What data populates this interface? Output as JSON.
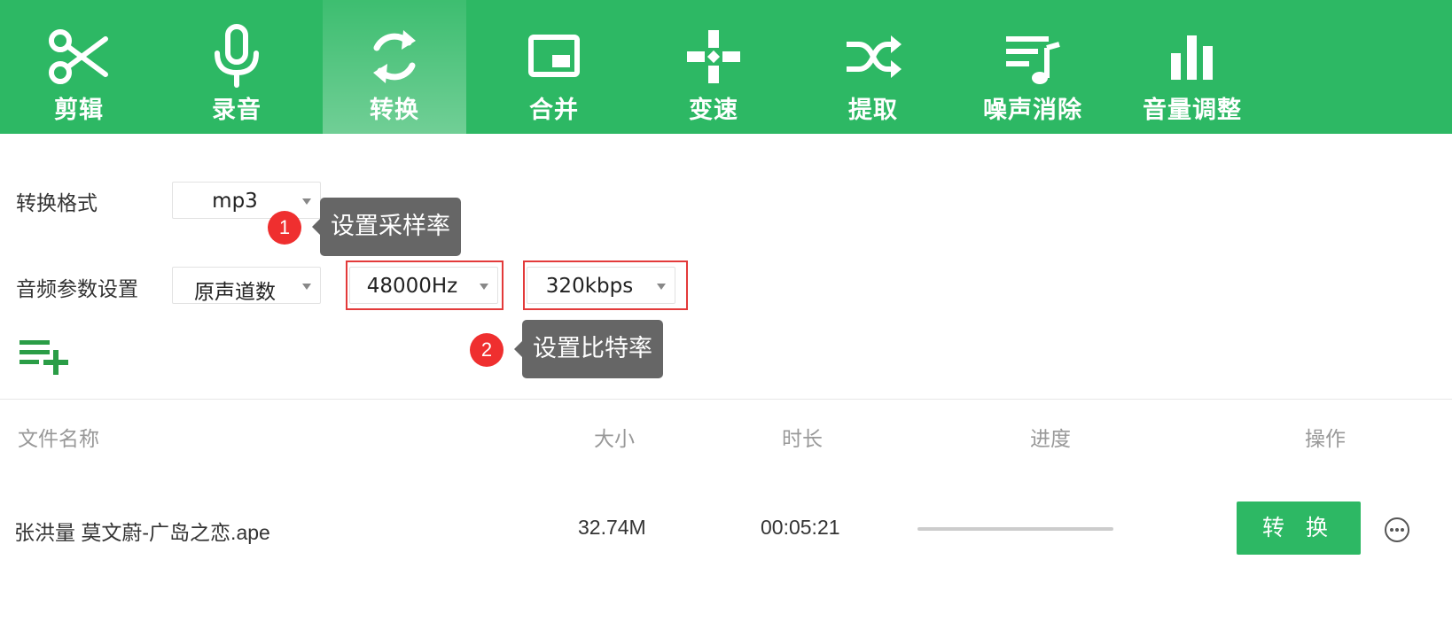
{
  "toolbar": {
    "items": [
      {
        "label": "剪辑",
        "icon": "scissors-icon"
      },
      {
        "label": "录音",
        "icon": "microphone-icon"
      },
      {
        "label": "转换",
        "icon": "convert-icon",
        "active": true
      },
      {
        "label": "合并",
        "icon": "merge-icon"
      },
      {
        "label": "变速",
        "icon": "speed-icon"
      },
      {
        "label": "提取",
        "icon": "extract-icon"
      },
      {
        "label": "噪声消除",
        "icon": "noise-removal-icon"
      },
      {
        "label": "音量调整",
        "icon": "volume-adjust-icon"
      }
    ]
  },
  "settings": {
    "format_label": "转换格式",
    "format_value": "mp3",
    "audio_params_label": "音频参数设置",
    "channels_value": "原声道数",
    "sample_rate_value": "48000Hz",
    "bitrate_value": "320kbps"
  },
  "tips": [
    {
      "number": "1",
      "text": "设置采样率"
    },
    {
      "number": "2",
      "text": "设置比特率"
    }
  ],
  "table": {
    "headers": {
      "name": "文件名称",
      "size": "大小",
      "duration": "时长",
      "progress": "进度",
      "actions": "操作"
    },
    "rows": [
      {
        "name": "张洪量 莫文蔚-广岛之恋.ape",
        "size": "32.74M",
        "duration": "00:05:21",
        "progress": 0,
        "action_label": "转 换"
      }
    ]
  },
  "colors": {
    "brand_green": "#2db864",
    "highlight_red": "#e33a3a",
    "badge_red": "#ef2f2f",
    "tooltip_gray": "#666666"
  }
}
